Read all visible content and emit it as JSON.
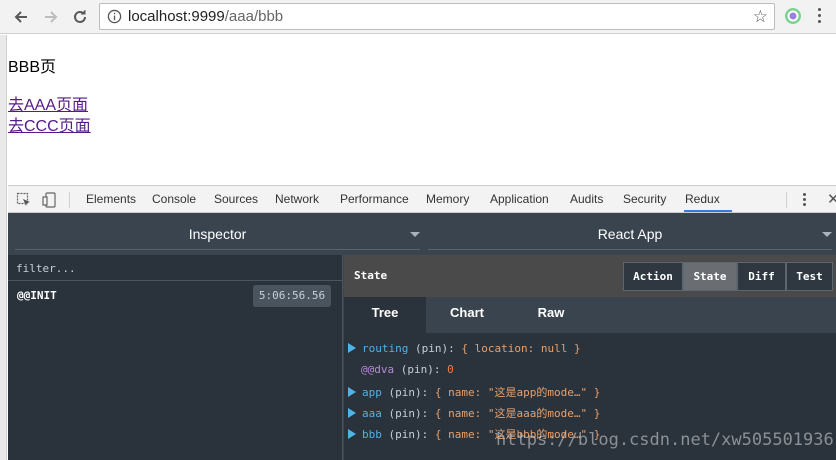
{
  "browser": {
    "url_host": "localhost:9999",
    "url_path": "/aaa/bbb",
    "colors": {
      "accent": "#3879d9",
      "link": "#551a8b"
    }
  },
  "page": {
    "title": "BBB页",
    "links": [
      "去AAA页面",
      "去CCC页面"
    ]
  },
  "devtools": {
    "tabs": [
      "Elements",
      "Console",
      "Sources",
      "Network",
      "Performance",
      "Memory",
      "Application",
      "Audits",
      "Security",
      "Redux"
    ],
    "active_tab": "Redux"
  },
  "redux": {
    "monitor_dropdown": "Inspector",
    "app_dropdown": "React App",
    "filter_placeholder": "filter...",
    "actions": [
      {
        "name": "@@INIT",
        "time": "5:06:56.56"
      }
    ],
    "state_title": "State",
    "segment_buttons": [
      "Action",
      "State",
      "Diff",
      "Test"
    ],
    "active_segment": "State",
    "subtabs": [
      "Tree",
      "Chart",
      "Raw"
    ],
    "active_subtab": "Tree",
    "tree": [
      {
        "key": "routing",
        "meta": "(pin):",
        "value": "{ location: null }",
        "expandable": true
      },
      {
        "key": "@@dva",
        "meta": "(pin):",
        "value": "0",
        "expandable": false
      },
      {
        "key": "app",
        "meta": "(pin):",
        "value": "{ name: \"这是app的mode…\" }",
        "expandable": true
      },
      {
        "key": "aaa",
        "meta": "(pin):",
        "value": "{ name: \"这是aaa的mode…\" }",
        "expandable": true
      },
      {
        "key": "bbb",
        "meta": "(pin):",
        "value": "{ name: \"这是bbb的mode…\" }",
        "expandable": true
      }
    ]
  },
  "watermark": "https://blog.csdn.net/xw505501936"
}
